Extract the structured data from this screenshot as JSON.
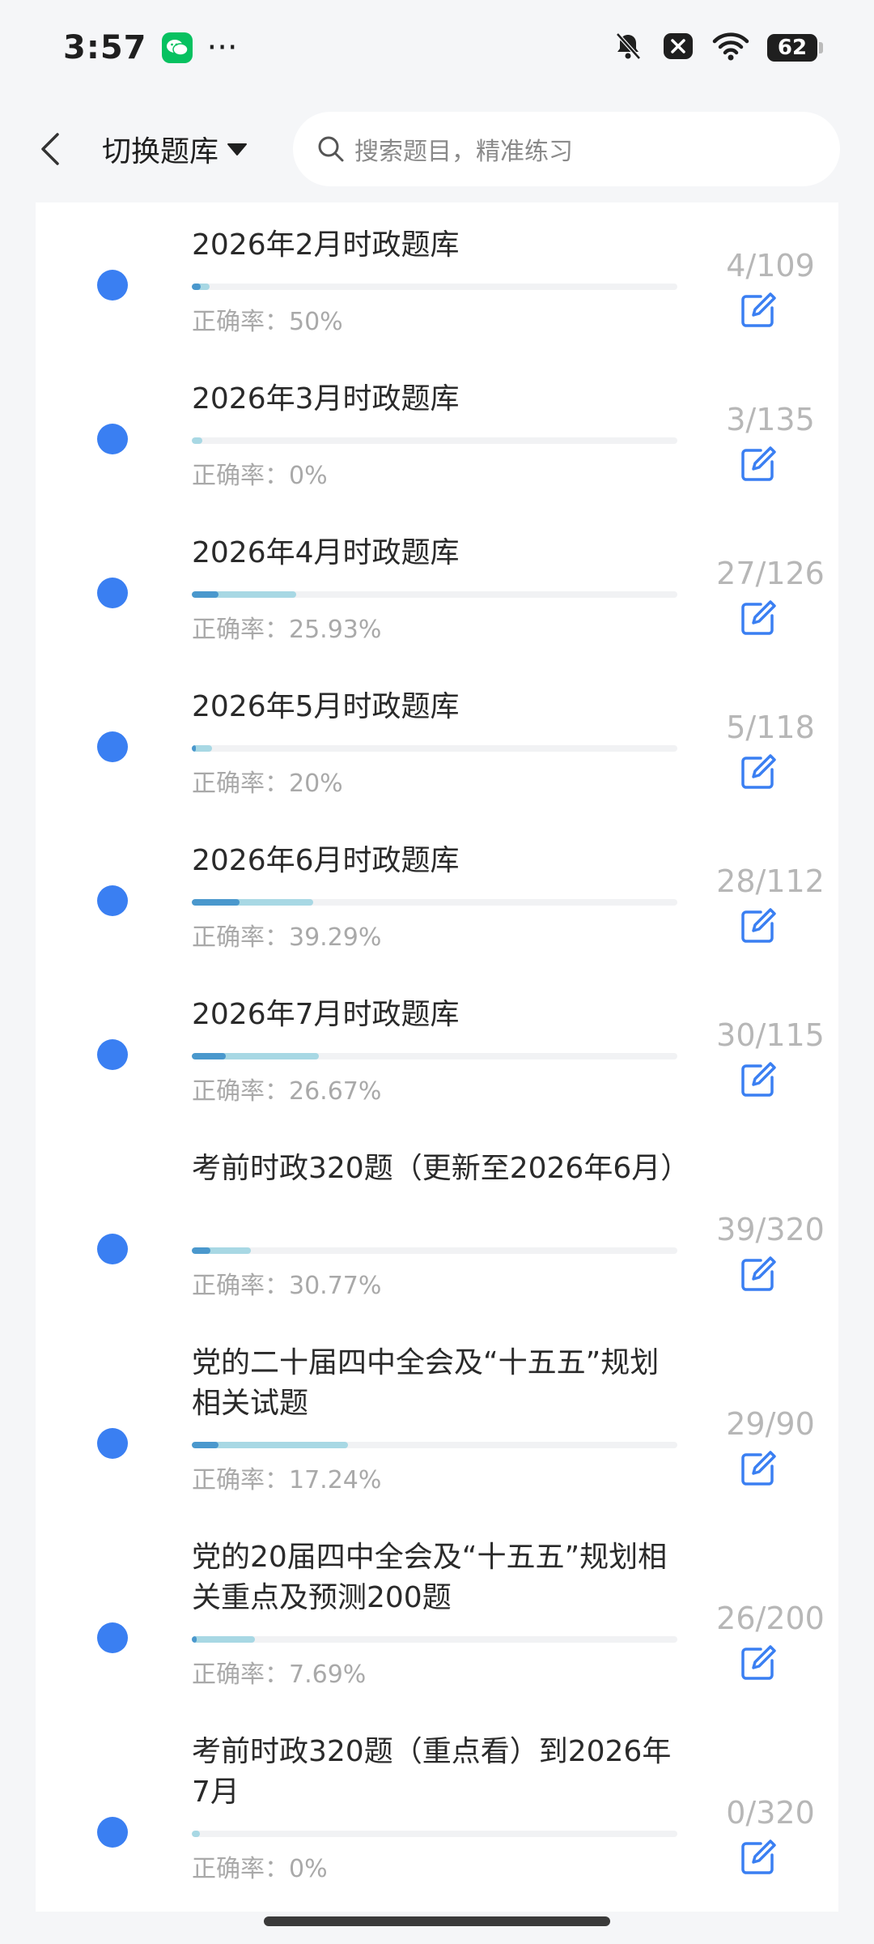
{
  "status_bar": {
    "time": "3:57",
    "more": "···",
    "battery": "62",
    "icons": [
      "wechat-icon",
      "bell-muted-icon",
      "close-box-icon",
      "wifi-icon",
      "battery-icon"
    ]
  },
  "header": {
    "switch_label": "切换题库",
    "search_placeholder": "搜索题目，精准练习"
  },
  "accuracy_prefix": "正确率：",
  "items": [
    {
      "title": "2026年2月时政题库",
      "done": 4,
      "total": 109,
      "count": "4/109",
      "accuracy": "50%",
      "accuracy_value": 50
    },
    {
      "title": "2026年3月时政题库",
      "done": 3,
      "total": 135,
      "count": "3/135",
      "accuracy": "0%",
      "accuracy_value": 0
    },
    {
      "title": "2026年4月时政题库",
      "done": 27,
      "total": 126,
      "count": "27/126",
      "accuracy": "25.93%",
      "accuracy_value": 25.93
    },
    {
      "title": "2026年5月时政题库",
      "done": 5,
      "total": 118,
      "count": "5/118",
      "accuracy": "20%",
      "accuracy_value": 20
    },
    {
      "title": "2026年6月时政题库",
      "done": 28,
      "total": 112,
      "count": "28/112",
      "accuracy": "39.29%",
      "accuracy_value": 39.29
    },
    {
      "title": "2026年7月时政题库",
      "done": 30,
      "total": 115,
      "count": "30/115",
      "accuracy": "26.67%",
      "accuracy_value": 26.67
    },
    {
      "title": "考前时政320题（更新至2026年6月）",
      "done": 39,
      "total": 320,
      "count": "39/320",
      "accuracy": "30.77%",
      "accuracy_value": 30.77
    },
    {
      "title": "党的二十届四中全会及“十五五”规划相关试题",
      "done": 29,
      "total": 90,
      "count": "29/90",
      "accuracy": "17.24%",
      "accuracy_value": 17.24
    },
    {
      "title": "党的20届四中全会及“十五五”规划相关重点及预测200题",
      "done": 26,
      "total": 200,
      "count": "26/200",
      "accuracy": "7.69%",
      "accuracy_value": 7.69
    },
    {
      "title": "考前时政320题（重点看）到2026年7月",
      "done": 0,
      "total": 320,
      "count": "0/320",
      "accuracy": "0%",
      "accuracy_value": 0
    }
  ],
  "colors": {
    "accent": "#3a7ff2",
    "progress_light": "#a8d8e4",
    "progress_dark": "#4a98cd",
    "muted_text": "#a9a9a9"
  }
}
